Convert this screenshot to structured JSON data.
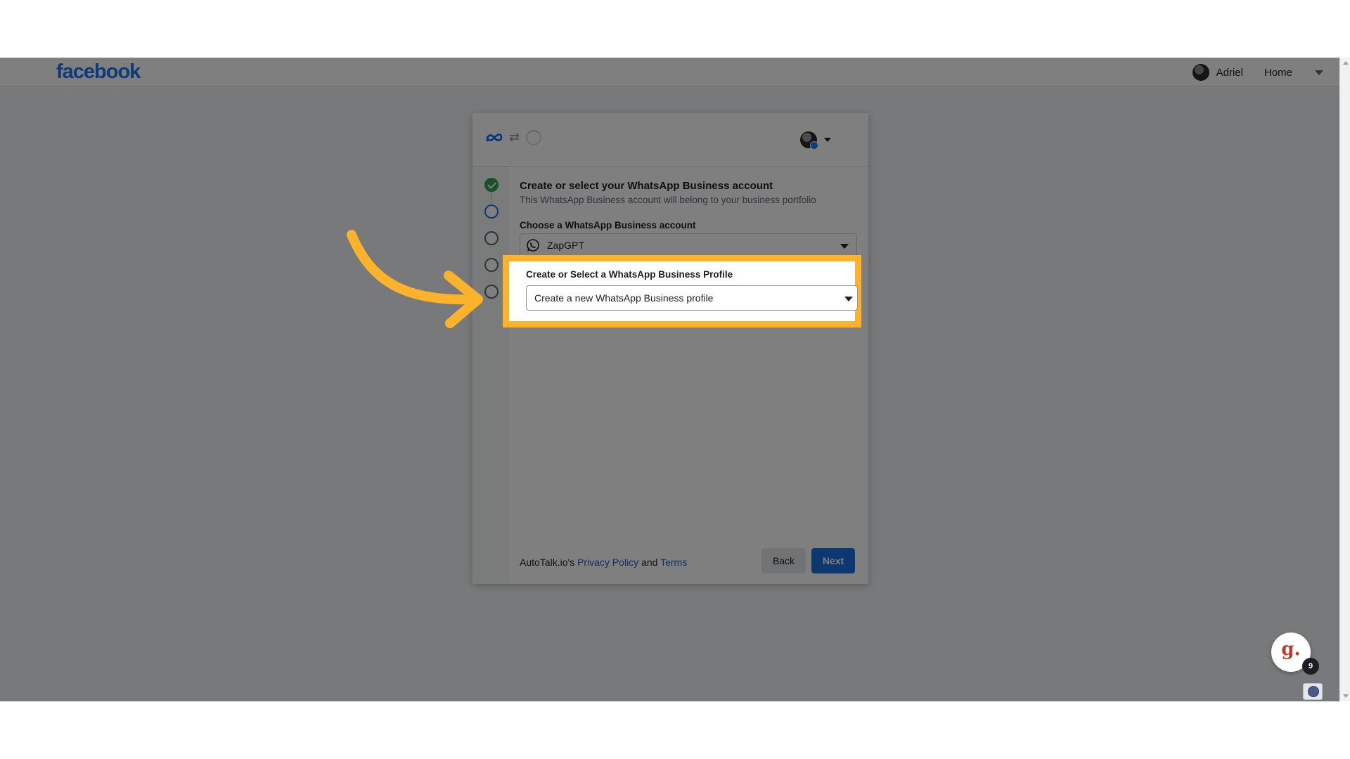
{
  "header": {
    "logo": "facebook",
    "user_name": "Adriel",
    "home_label": "Home"
  },
  "modal": {
    "title": "Create or select your WhatsApp Business account",
    "subtitle": "This WhatsApp Business account will belong to your business portfolio",
    "account_label": "Choose a WhatsApp Business account",
    "account_value": "ZapGPT",
    "profile_label": "Create or Select a WhatsApp Business Profile",
    "profile_value": "Create a new WhatsApp Business profile",
    "policy_prefix": "AutoTalk.io's",
    "privacy_link": "Privacy Policy",
    "policy_and": "and",
    "terms_link": "Terms",
    "back_label": "Back",
    "next_label": "Next",
    "steps": [
      "done",
      "active",
      "pending",
      "pending",
      "pending"
    ]
  },
  "widget": {
    "letter": "g.",
    "count": "9"
  },
  "colors": {
    "facebook_blue": "#1877f2",
    "highlight": "#fcb22b",
    "next_button": "#1b6fe0",
    "step_done": "#31a24c"
  },
  "icons": [
    "meta-icon",
    "swap-icon",
    "spinner-icon",
    "whatsapp-icon",
    "chevron-down-icon",
    "globe-icon",
    "check-icon",
    "arrow-pointer"
  ]
}
